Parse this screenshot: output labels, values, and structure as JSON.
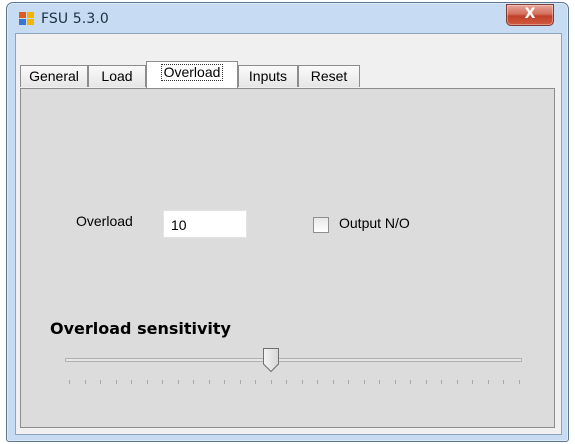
{
  "window": {
    "title": "FSU 5.3.0",
    "close_label": "X"
  },
  "tabs": [
    {
      "label": "General",
      "active": false
    },
    {
      "label": "Load",
      "active": false
    },
    {
      "label": "Overload",
      "active": true
    },
    {
      "label": "Inputs",
      "active": false
    },
    {
      "label": "Reset",
      "active": false
    }
  ],
  "overload_tab": {
    "overload_label": "Overload",
    "overload_value": "10",
    "output_checkbox_label": "Output N/O",
    "output_checkbox_checked": false,
    "sensitivity_title": "Overload sensitivity",
    "slider_value_fraction": 0.45,
    "slider_tick_count": 30
  },
  "colors": {
    "panel_bg": "#dcdcdc",
    "titlebar_bg": "#c7dcf2",
    "close_button": "#c0402a"
  }
}
